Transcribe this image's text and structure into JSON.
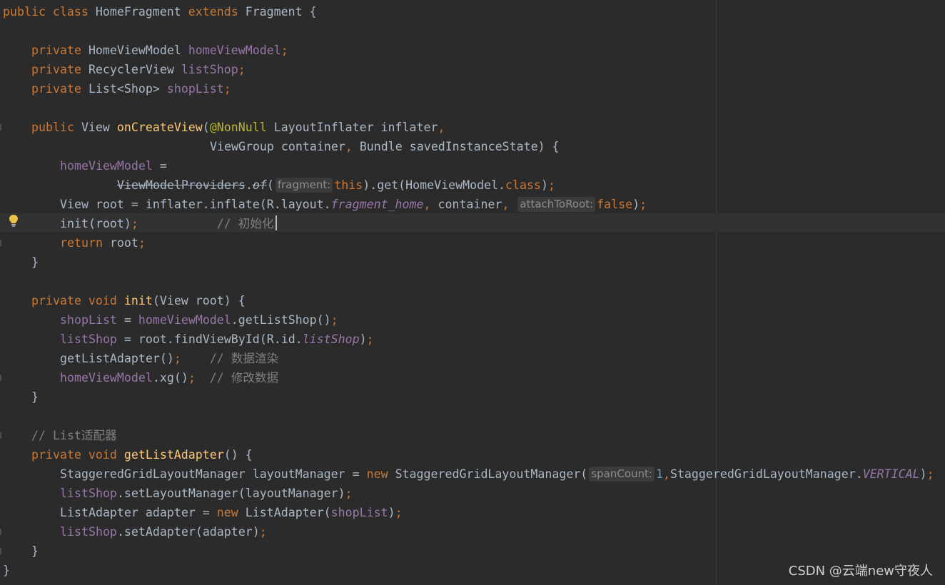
{
  "editor": {
    "language": "java",
    "caret_line": 12,
    "lines": [
      {
        "indent": 0,
        "tokens": [
          [
            "public class ",
            "k"
          ],
          [
            "HomeFragment ",
            ""
          ],
          [
            "extends ",
            "k"
          ],
          [
            "Fragment {",
            ""
          ]
        ]
      },
      {
        "indent": 0,
        "tokens": []
      },
      {
        "indent": 1,
        "tokens": [
          [
            "private ",
            "k"
          ],
          [
            "HomeViewModel ",
            ""
          ],
          [
            "homeViewModel",
            "f"
          ],
          [
            ";",
            "k"
          ]
        ]
      },
      {
        "indent": 1,
        "tokens": [
          [
            "private ",
            "k"
          ],
          [
            "RecyclerView ",
            ""
          ],
          [
            "listShop",
            "f"
          ],
          [
            ";",
            "k"
          ]
        ]
      },
      {
        "indent": 1,
        "tokens": [
          [
            "private ",
            "k"
          ],
          [
            "List<Shop> ",
            ""
          ],
          [
            "shopList",
            "f"
          ],
          [
            ";",
            "k"
          ]
        ]
      },
      {
        "indent": 0,
        "tokens": []
      },
      {
        "indent": 1,
        "tokens": [
          [
            "public ",
            "k"
          ],
          [
            "View ",
            ""
          ],
          [
            "onCreateView",
            "m"
          ],
          [
            "(",
            ""
          ],
          [
            "@NonNull ",
            "a"
          ],
          [
            "LayoutInflater inflater",
            ""
          ],
          [
            ",",
            "k"
          ]
        ]
      },
      {
        "indent": 7.25,
        "tokens": [
          [
            "ViewGroup container",
            ""
          ],
          [
            ", ",
            "k"
          ],
          [
            "Bundle savedInstanceState) {",
            ""
          ]
        ]
      },
      {
        "indent": 2,
        "tokens": [
          [
            "homeViewModel ",
            "f"
          ],
          [
            "=",
            ""
          ]
        ]
      },
      {
        "indent": 4,
        "tokens": [
          [
            "ViewModelProviders",
            "d"
          ],
          [
            ".",
            ""
          ],
          [
            "of",
            "di"
          ],
          [
            "(",
            ""
          ],
          [
            "fragment:",
            "h"
          ],
          [
            "this",
            "k"
          ],
          [
            ").get(HomeViewModel.",
            ""
          ],
          [
            "class",
            "k"
          ],
          [
            ")",
            ""
          ],
          [
            ";",
            "k"
          ]
        ]
      },
      {
        "indent": 2,
        "tokens": [
          [
            "View root = inflater.inflate(R.layout.",
            ""
          ],
          [
            "fragment_home",
            "fi"
          ],
          [
            ", ",
            "k"
          ],
          [
            "container",
            ""
          ],
          [
            ", ",
            "k"
          ],
          [
            "attachToRoot:",
            "h"
          ],
          [
            "false",
            "k"
          ],
          [
            ")",
            ""
          ],
          [
            ";",
            "k"
          ]
        ]
      },
      {
        "indent": 2,
        "tokens": [
          [
            "init(root)",
            ""
          ],
          [
            ";",
            "k"
          ],
          [
            "           // 初始化",
            "c"
          ]
        ]
      },
      {
        "indent": 2,
        "tokens": [
          [
            "return ",
            "k"
          ],
          [
            "root",
            ""
          ],
          [
            ";",
            "k"
          ]
        ]
      },
      {
        "indent": 1,
        "tokens": [
          [
            "}",
            ""
          ]
        ]
      },
      {
        "indent": 0,
        "tokens": []
      },
      {
        "indent": 1,
        "tokens": [
          [
            "private void ",
            "k"
          ],
          [
            "init",
            "m"
          ],
          [
            "(View root) {",
            ""
          ]
        ]
      },
      {
        "indent": 2,
        "tokens": [
          [
            "shopList ",
            "f"
          ],
          [
            "= ",
            ""
          ],
          [
            "homeViewModel",
            "f"
          ],
          [
            ".getListShop()",
            ""
          ],
          [
            ";",
            "k"
          ]
        ]
      },
      {
        "indent": 2,
        "tokens": [
          [
            "listShop ",
            "f"
          ],
          [
            "= root.findViewById(R.id.",
            ""
          ],
          [
            "listShop",
            "fi"
          ],
          [
            ")",
            ""
          ],
          [
            ";",
            "k"
          ]
        ]
      },
      {
        "indent": 2,
        "tokens": [
          [
            "getListAdapter()",
            ""
          ],
          [
            ";",
            "k"
          ],
          [
            "    // 数据渲染",
            "c"
          ]
        ]
      },
      {
        "indent": 2,
        "tokens": [
          [
            "homeViewModel",
            "f"
          ],
          [
            ".xg()",
            ""
          ],
          [
            ";",
            "k"
          ],
          [
            "  // 修改数据",
            "c"
          ]
        ]
      },
      {
        "indent": 1,
        "tokens": [
          [
            "}",
            ""
          ]
        ]
      },
      {
        "indent": 0,
        "tokens": []
      },
      {
        "indent": 1,
        "tokens": [
          [
            "// List适配器",
            "c"
          ]
        ]
      },
      {
        "indent": 1,
        "tokens": [
          [
            "private void ",
            "k"
          ],
          [
            "getListAdapter",
            "m"
          ],
          [
            "() {",
            ""
          ]
        ]
      },
      {
        "indent": 2,
        "tokens": [
          [
            "StaggeredGridLayoutManager layoutManager = ",
            ""
          ],
          [
            "new ",
            "k"
          ],
          [
            "StaggeredGridLayoutManager(",
            ""
          ],
          [
            "spanCount:",
            "h"
          ],
          [
            "1",
            "n"
          ],
          [
            ",",
            "k"
          ],
          [
            "StaggeredGridLayoutManager.",
            ""
          ],
          [
            "VERTICAL",
            "fi"
          ],
          [
            ")",
            ""
          ],
          [
            ";",
            "k"
          ]
        ]
      },
      {
        "indent": 2,
        "tokens": [
          [
            "listShop",
            "f"
          ],
          [
            ".setLayoutManager(layoutManager)",
            ""
          ],
          [
            ";",
            "k"
          ]
        ]
      },
      {
        "indent": 2,
        "tokens": [
          [
            "ListAdapter adapter = ",
            ""
          ],
          [
            "new ",
            "k"
          ],
          [
            "ListAdapter(",
            ""
          ],
          [
            "shopList",
            "f"
          ],
          [
            ")",
            ""
          ],
          [
            ";",
            "k"
          ]
        ]
      },
      {
        "indent": 2,
        "tokens": [
          [
            "listShop",
            "f"
          ],
          [
            ".setAdapter(adapter)",
            ""
          ],
          [
            ";",
            "k"
          ]
        ]
      },
      {
        "indent": 1,
        "tokens": [
          [
            "}",
            ""
          ]
        ]
      },
      {
        "indent": 0,
        "tokens": [
          [
            "}",
            ""
          ]
        ]
      }
    ],
    "fold_markers": [
      7,
      13,
      20,
      23,
      28,
      29
    ]
  },
  "icons": {
    "gutter": "lightbulb-icon"
  },
  "colors": {
    "background": "#2b2b2b",
    "caret_row": "#323232",
    "keyword": "#cc7832",
    "field": "#9876aa",
    "method": "#ffc66d",
    "annotation": "#bbb529",
    "comment": "#808080",
    "number": "#6897bb",
    "default_text": "#a9b7c6",
    "lightbulb": "#e8c046"
  },
  "watermark": "CSDN @云端new守夜人"
}
